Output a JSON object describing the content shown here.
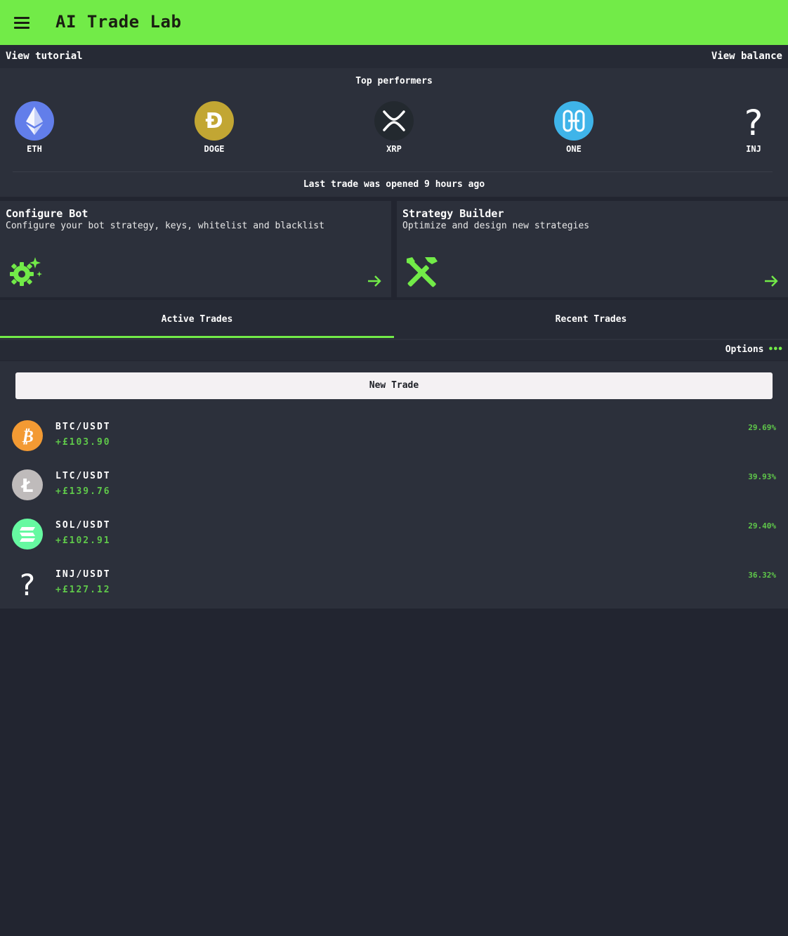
{
  "app": {
    "title": "AI Trade Lab",
    "accent_color": "#72eb48",
    "menu_icon": "hamburger-menu-icon"
  },
  "links": {
    "tutorial": "View tutorial",
    "balance": "View balance"
  },
  "top_performers": {
    "title": "Top performers",
    "items": [
      {
        "symbol": "ETH",
        "icon": "ethereum-icon",
        "color": "#627eea"
      },
      {
        "symbol": "DOGE",
        "icon": "dogecoin-icon",
        "color": "#c2a633"
      },
      {
        "symbol": "XRP",
        "icon": "xrp-icon",
        "color": "#23292f"
      },
      {
        "symbol": "ONE",
        "icon": "harmony-icon",
        "color": "#3fb4e9"
      },
      {
        "symbol": "INJ",
        "icon": "question-mark-icon",
        "color": "#ffffff"
      }
    ],
    "last_trade": "Last trade was opened 9 hours ago"
  },
  "cards": [
    {
      "title": "Configure Bot",
      "subtitle": "Configure your bot strategy, keys, whitelist and blacklist",
      "icon": "gear-sparkle-icon"
    },
    {
      "title": "Strategy Builder",
      "subtitle": "Optimize and design new strategies",
      "icon": "tools-icon"
    }
  ],
  "tabs": [
    {
      "label": "Active Trades",
      "active": true
    },
    {
      "label": "Recent Trades",
      "active": false
    }
  ],
  "options_label": "Options",
  "new_trade_label": "New Trade",
  "trades": [
    {
      "pair": "BTC/USDT",
      "profit": "+£103.90",
      "percent": "29.69%",
      "icon": "bitcoin-icon",
      "color": "#f39a33"
    },
    {
      "pair": "LTC/USDT",
      "profit": "+£139.76",
      "percent": "39.93%",
      "icon": "litecoin-icon",
      "color": "#bfbbbb"
    },
    {
      "pair": "SOL/USDT",
      "profit": "+£102.91",
      "percent": "29.40%",
      "icon": "solana-icon",
      "color": "#66f9a1"
    },
    {
      "pair": "INJ/USDT",
      "profit": "+£127.12",
      "percent": "36.32%",
      "icon": "question-mark-icon",
      "color": "#ffffff"
    }
  ]
}
